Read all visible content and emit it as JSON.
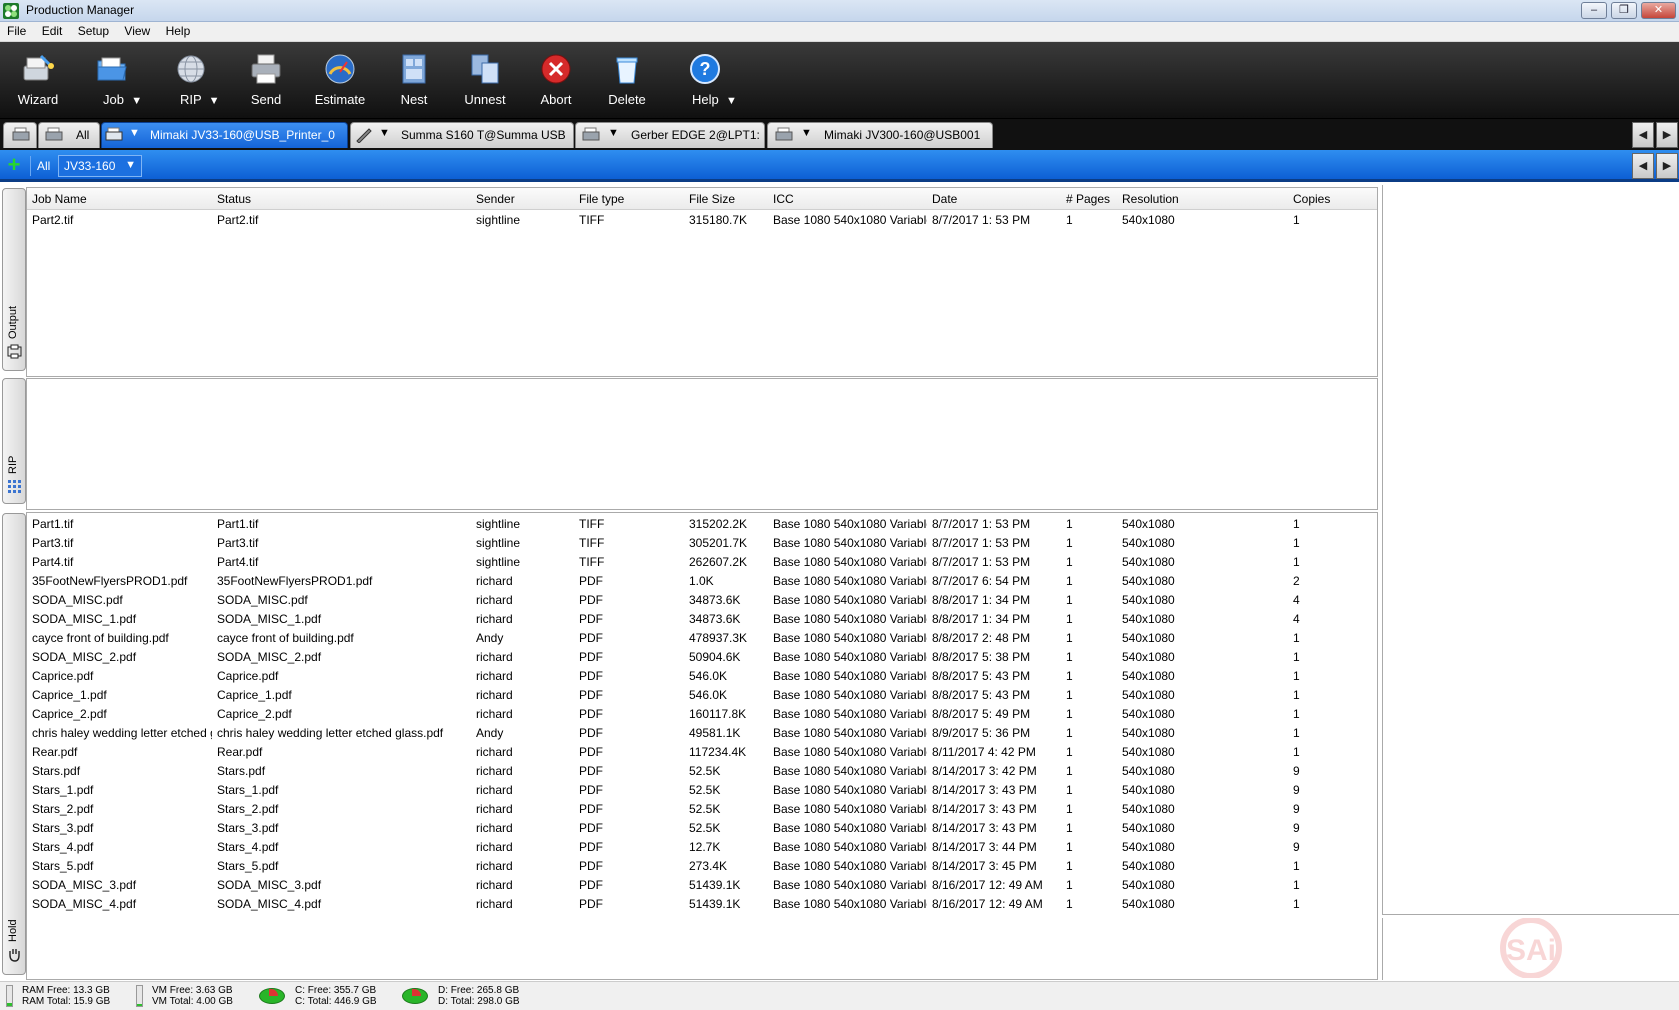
{
  "window": {
    "title": "Production Manager",
    "controls": [
      "–",
      "❐",
      "✕"
    ]
  },
  "menu": [
    "File",
    "Edit",
    "Setup",
    "View",
    "Help"
  ],
  "toolbar": {
    "items": [
      {
        "label": "Wizard",
        "icon": "wizard-icon",
        "dropdown": false
      },
      {
        "label": "Job",
        "icon": "folder-icon",
        "dropdown": true
      },
      {
        "label": "RIP",
        "icon": "globe-icon",
        "dropdown": true
      },
      {
        "label": "Send",
        "icon": "printer-icon",
        "dropdown": false
      },
      {
        "label": "Estimate",
        "icon": "gauge-icon",
        "dropdown": false
      },
      {
        "label": "Nest",
        "icon": "nest-icon",
        "dropdown": false
      },
      {
        "label": "Unnest",
        "icon": "unnest-icon",
        "dropdown": false
      },
      {
        "label": "Abort",
        "icon": "abort-icon",
        "dropdown": false
      },
      {
        "label": "Delete",
        "icon": "trash-icon",
        "dropdown": false
      },
      {
        "label": "Help",
        "icon": "help-icon",
        "dropdown": true
      }
    ],
    "dropdown_glyph": "▼"
  },
  "printer_tabs": {
    "all_label": "All",
    "dropdown_glyph": "▼",
    "tabs": [
      {
        "name": "Mimaki JV33-160@USB_Printer_0",
        "active": true
      },
      {
        "name": "Summa S160 T@Summa USB",
        "active": false
      },
      {
        "name": "Gerber EDGE 2@LPT1:",
        "active": false
      },
      {
        "name": "Mimaki JV300-160@USB001",
        "active": false
      }
    ],
    "nav_left": "◀",
    "nav_right": "▶"
  },
  "queue_bar": {
    "add_glyph": "+",
    "all_label": "All",
    "selected": "JV33-160",
    "dropdown_glyph": "▼"
  },
  "columns": [
    "Job Name",
    "Status",
    "Sender",
    "File type",
    "File Size",
    "ICC",
    "Date",
    "# Pages",
    "Resolution",
    "Copies"
  ],
  "side_tabs": {
    "output": "Output",
    "rip": "RIP",
    "hold": "Hold"
  },
  "output_jobs": [
    [
      "Part2.tif",
      "Part2.tif",
      "sightline",
      "TIFF",
      "315180.7K",
      "Base 1080 540x1080 Variable c",
      "8/7/2017 1: 53 PM",
      "1",
      "540x1080",
      "1"
    ]
  ],
  "hold_jobs": [
    [
      "Part1.tif",
      "Part1.tif",
      "sightline",
      "TIFF",
      "315202.2K",
      "Base 1080 540x1080 Variable c",
      "8/7/2017 1: 53 PM",
      "1",
      "540x1080",
      "1"
    ],
    [
      "Part3.tif",
      "Part3.tif",
      "sightline",
      "TIFF",
      "305201.7K",
      "Base 1080 540x1080 Variable c",
      "8/7/2017 1: 53 PM",
      "1",
      "540x1080",
      "1"
    ],
    [
      "Part4.tif",
      "Part4.tif",
      "sightline",
      "TIFF",
      "262607.2K",
      "Base 1080 540x1080 Variable c",
      "8/7/2017 1: 53 PM",
      "1",
      "540x1080",
      "1"
    ],
    [
      "35FootNewFlyersPROD1.pdf",
      "35FootNewFlyersPROD1.pdf",
      "richard",
      "PDF",
      "1.0K",
      "Base 1080 540x1080 Variable c",
      "8/7/2017 6: 54 PM",
      "1",
      "540x1080",
      "2"
    ],
    [
      "SODA_MISC.pdf",
      "SODA_MISC.pdf",
      "richard",
      "PDF",
      "34873.6K",
      "Base 1080 540x1080 Variable c",
      "8/8/2017 1: 34 PM",
      "1",
      "540x1080",
      "4"
    ],
    [
      "SODA_MISC_1.pdf",
      "SODA_MISC_1.pdf",
      "richard",
      "PDF",
      "34873.6K",
      "Base 1080 540x1080 Variable c",
      "8/8/2017 1: 34 PM",
      "1",
      "540x1080",
      "4"
    ],
    [
      "cayce front of building.pdf",
      "cayce front of building.pdf",
      "Andy",
      "PDF",
      "478937.3K",
      "Base 1080 540x1080 Variable c",
      "8/8/2017 2: 48 PM",
      "1",
      "540x1080",
      "1"
    ],
    [
      "SODA_MISC_2.pdf",
      "SODA_MISC_2.pdf",
      "richard",
      "PDF",
      "50904.6K",
      "Base 1080 540x1080 Variable c",
      "8/8/2017 5: 38 PM",
      "1",
      "540x1080",
      "1"
    ],
    [
      "Caprice.pdf",
      "Caprice.pdf",
      "richard",
      "PDF",
      "546.0K",
      "Base 1080 540x1080 Variable c",
      "8/8/2017 5: 43 PM",
      "1",
      "540x1080",
      "1"
    ],
    [
      "Caprice_1.pdf",
      "Caprice_1.pdf",
      "richard",
      "PDF",
      "546.0K",
      "Base 1080 540x1080 Variable c",
      "8/8/2017 5: 43 PM",
      "1",
      "540x1080",
      "1"
    ],
    [
      "Caprice_2.pdf",
      "Caprice_2.pdf",
      "richard",
      "PDF",
      "160117.8K",
      "Base 1080 540x1080 Variable c",
      "8/8/2017 5: 49 PM",
      "1",
      "540x1080",
      "1"
    ],
    [
      "chris haley wedding letter etched g",
      "chris haley wedding letter etched glass.pdf",
      "Andy",
      "PDF",
      "49581.1K",
      "Base 1080 540x1080 Variable c",
      "8/9/2017 5: 36 PM",
      "1",
      "540x1080",
      "1"
    ],
    [
      "Rear.pdf",
      "Rear.pdf",
      "richard",
      "PDF",
      "117234.4K",
      "Base 1080 540x1080 Variable c",
      "8/11/2017 4: 42 PM",
      "1",
      "540x1080",
      "1"
    ],
    [
      "Stars.pdf",
      "Stars.pdf",
      "richard",
      "PDF",
      "52.5K",
      "Base 1080 540x1080 Variable c",
      "8/14/2017 3: 42 PM",
      "1",
      "540x1080",
      "9"
    ],
    [
      "Stars_1.pdf",
      "Stars_1.pdf",
      "richard",
      "PDF",
      "52.5K",
      "Base 1080 540x1080 Variable c",
      "8/14/2017 3: 43 PM",
      "1",
      "540x1080",
      "9"
    ],
    [
      "Stars_2.pdf",
      "Stars_2.pdf",
      "richard",
      "PDF",
      "52.5K",
      "Base 1080 540x1080 Variable c",
      "8/14/2017 3: 43 PM",
      "1",
      "540x1080",
      "9"
    ],
    [
      "Stars_3.pdf",
      "Stars_3.pdf",
      "richard",
      "PDF",
      "52.5K",
      "Base 1080 540x1080 Variable c",
      "8/14/2017 3: 43 PM",
      "1",
      "540x1080",
      "9"
    ],
    [
      "Stars_4.pdf",
      "Stars_4.pdf",
      "richard",
      "PDF",
      "12.7K",
      "Base 1080 540x1080 Variable c",
      "8/14/2017 3: 44 PM",
      "1",
      "540x1080",
      "9"
    ],
    [
      "Stars_5.pdf",
      "Stars_5.pdf",
      "richard",
      "PDF",
      "273.4K",
      "Base 1080 540x1080 Variable c",
      "8/14/2017 3: 45 PM",
      "1",
      "540x1080",
      "1"
    ],
    [
      "SODA_MISC_3.pdf",
      "SODA_MISC_3.pdf",
      "richard",
      "PDF",
      "51439.1K",
      "Base 1080 540x1080 Variable c",
      "8/16/2017 12: 49 AM",
      "1",
      "540x1080",
      "1"
    ],
    [
      "SODA_MISC_4.pdf",
      "SODA_MISC_4.pdf",
      "richard",
      "PDF",
      "51439.1K",
      "Base 1080 540x1080 Variable c",
      "8/16/2017 12: 49 AM",
      "1",
      "540x1080",
      "1"
    ]
  ],
  "watermark": "SAi",
  "status": {
    "ram_free": "RAM Free: 13.3 GB",
    "ram_total": "RAM Total: 15.9 GB",
    "ram_used_fraction": 0.16,
    "vm_free": "VM Free: 3.63 GB",
    "vm_total": "VM Total: 4.00 GB",
    "vm_used_fraction": 0.09,
    "c_free": "C: Free: 355.7 GB",
    "c_total": "C: Total: 446.9 GB",
    "d_free": "D: Free: 265.8 GB",
    "d_total": "D: Total: 298.0 GB"
  },
  "colors": {
    "active_tab": "#1a6de0",
    "queue_bar": "#2f8ef0",
    "toolbar_bg": "#1c1c1c"
  }
}
